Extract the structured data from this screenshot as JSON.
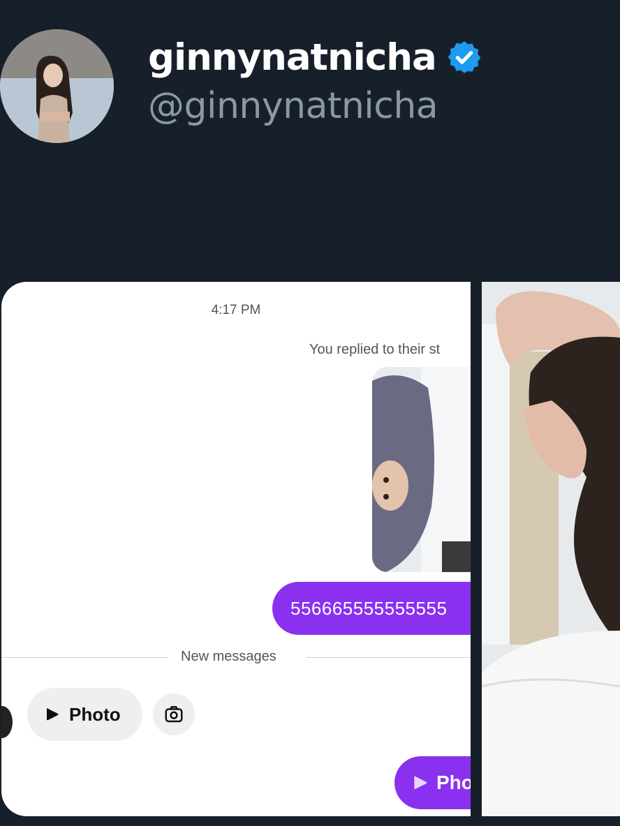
{
  "profile": {
    "display_name": "ginnynatnicha",
    "handle": "@ginnynatnicha",
    "verified_color": "#1d9bf0"
  },
  "dm": {
    "time": "4:17 PM",
    "replied_note": "You replied to their st",
    "message": "556665555555555",
    "divider_label": "New messages",
    "photo_chip_label": "Photo",
    "photo_chip_purple_label": "Pho",
    "accent_color": "#8a31f0"
  },
  "icons": {
    "verified": "verified-badge-icon",
    "play": "play-icon",
    "camera": "camera-icon"
  }
}
